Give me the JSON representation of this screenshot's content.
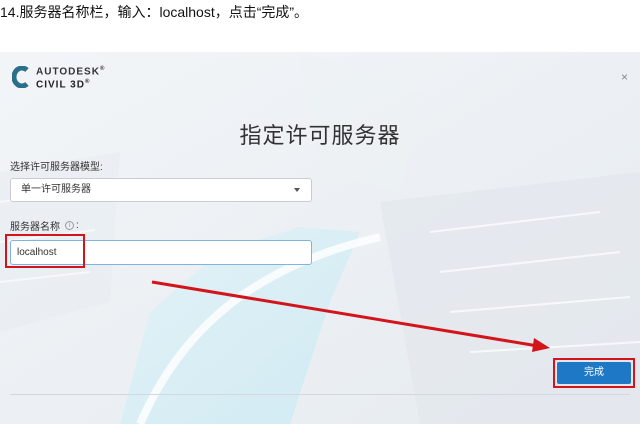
{
  "caption": "14.服务器名称栏，输入：localhost，点击“完成”。",
  "dialog": {
    "brand": "AUTODESK",
    "brand_mark": "®",
    "product": "CIVIL 3D",
    "product_mark": "®",
    "close_glyph": "×",
    "title": "指定许可服务器",
    "model_label": "选择许可服务器模型:",
    "model_value": "单一许可服务器",
    "server_label": "服务器名称",
    "server_label_colon": ":",
    "server_value": "localhost",
    "finish_label": "完成"
  },
  "colors": {
    "accent": "#1f78c5",
    "highlight": "#d3141b",
    "input_border": "#7fb4df"
  },
  "icons": [
    "autodesk-c-logo-icon",
    "close-icon",
    "info-icon",
    "dropdown-caret-icon",
    "annotation-arrow"
  ]
}
